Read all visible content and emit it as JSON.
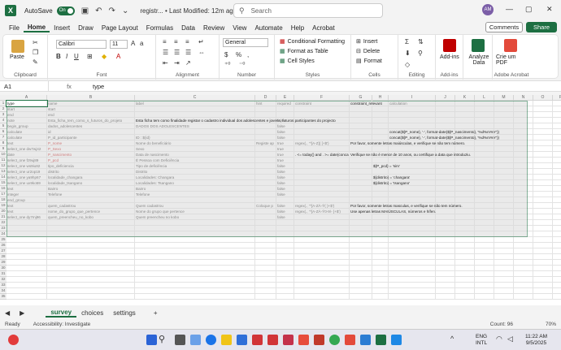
{
  "titlebar": {
    "app_letter": "X",
    "autosave_label": "AutoSave",
    "autosave_state": "On",
    "doc_title": "registr... • Last Modified: 12m ago",
    "search_placeholder": "Search",
    "avatar_initials": "AM"
  },
  "menu": {
    "items": [
      "File",
      "Home",
      "Insert",
      "Draw",
      "Page Layout",
      "Formulas",
      "Data",
      "Review",
      "View",
      "Automate",
      "Help",
      "Acrobat"
    ],
    "comments_label": "Comments",
    "share_label": "Share"
  },
  "ribbon": {
    "clipboard_label": "Clipboard",
    "paste_label": "Paste",
    "font_label": "Font",
    "font_name": "Calibri",
    "font_size": "11",
    "alignment_label": "Alignment",
    "number_label": "Number",
    "number_format": "General",
    "styles_label": "Styles",
    "conditional_formatting": "Conditional Formatting",
    "format_as_table": "Format as Table",
    "cell_styles": "Cell Styles",
    "cells_label": "Cells",
    "insert": "Insert",
    "delete": "Delete",
    "format": "Format",
    "editing_label": "Editing",
    "addins_group": "Add-ins",
    "addins_btn": "Add-ins",
    "analyze_data": "Analyze Data",
    "create_pdf": "Crie um PDF",
    "acrobat_label": "Adobe Acrobat"
  },
  "formula_bar": {
    "name_box": "A1",
    "fx": "fx",
    "value": "type"
  },
  "columns": [
    "A",
    "B",
    "C",
    "D",
    "E",
    "F",
    "G",
    "H",
    "I",
    "J",
    "K",
    "L",
    "M",
    "N",
    "O",
    "P"
  ],
  "rows": [
    [
      "type",
      "name",
      "label",
      "hint",
      "required",
      "constraint",
      "constraint_relevant",
      "",
      "calculation",
      "",
      "",
      "",
      "",
      "",
      "",
      ""
    ],
    [
      "start",
      "start",
      "",
      "",
      "",
      "",
      "",
      "",
      "",
      "",
      "",
      "",
      "",
      "",
      "",
      ""
    ],
    [
      "end",
      "end",
      "",
      "",
      "",
      "",
      "",
      "",
      "",
      "",
      "",
      "",
      "",
      "",
      "",
      ""
    ],
    [
      "note",
      "Esta_ficha_tem_como_s_futuros_do_projeto",
      "Esta ficha tem como finalidade registar o cadastro individual dos adolescentes e jovens, futuros participantes do projecto",
      "",
      "false",
      "",
      "",
      "",
      "",
      "",
      "",
      "",
      "",
      "",
      "",
      ""
    ],
    [
      "begin_group",
      "dados_adolescentes",
      "DADOS DOS ADOLESCENTES",
      "",
      "false",
      "",
      "",
      "",
      "",
      "",
      "",
      "",
      "",
      "",
      "",
      ""
    ],
    [
      "calculate",
      "id",
      "",
      "",
      "false",
      "",
      "",
      "",
      "concat(${P_nome}, '-', format-date(${P_nascimento}, '%d%m%Y'))",
      "",
      "",
      "",
      "",
      "",
      "",
      ""
    ],
    [
      "calculate",
      "P_id_participante",
      "ID : ${id}",
      "",
      "false",
      "",
      "",
      "",
      "concat(${P_nome}, '-', format-date(${P_nascimento}, '%d%m%Y'))",
      "",
      "",
      "",
      "",
      "",
      "",
      ""
    ],
    [
      "text",
      "P_nome",
      "Nome do beneficiário",
      "Registe ap",
      "true",
      "regex(., '^[A-Z]( [+$')",
      "Por favor, somente letras maiúsculas, e verifique se não tem número.",
      "",
      "",
      "",
      "",
      "",
      "",
      "",
      "",
      ""
    ],
    [
      "select_one dw7wj42",
      "P_Sexo",
      "Sexo",
      "",
      "true",
      "",
      "",
      "",
      "",
      "",
      "",
      "",
      "",
      "",
      "",
      ""
    ],
    [
      "date",
      "P_nascimento",
      "Data de nascimento",
      "",
      "true",
      ". <= today() and . >= date(conca",
      "Verifique se não é menor de 10 anos, ou certifique a data que introduziu.",
      "",
      "",
      "",
      "",
      "",
      "",
      "",
      "",
      ""
    ],
    [
      "select_one fz9uj89",
      "P_pcd",
      "É Pessoa com Deficiência",
      "",
      "true",
      "",
      "",
      "",
      "",
      "",
      "",
      "",
      "",
      "",
      "",
      ""
    ],
    [
      "select_one ws9iu82",
      "tipo_deficiencia",
      "Tipo de deficiência",
      "",
      "false",
      "",
      "",
      "${P_pcd} = 'sim'",
      "",
      "",
      "",
      "",
      "",
      "",
      "",
      ""
    ],
    [
      "select_one ur2op19",
      "distrito",
      "Distrito",
      "",
      "false",
      "",
      "",
      "",
      "",
      "",
      "",
      "",
      "",
      "",
      "",
      ""
    ],
    [
      "select_one ya9hp67",
      "localidade_changara",
      "Localidades: Changara",
      "",
      "false",
      "",
      "",
      "${distrito} = 'changara'",
      "",
      "",
      "",
      "",
      "",
      "",
      "",
      ""
    ],
    [
      "select_one ux9ko59",
      "localidade_tsangano",
      "Localidades: Tsangano",
      "",
      "false",
      "",
      "",
      "${distrito} = 'tsangano'",
      "",
      "",
      "",
      "",
      "",
      "",
      "",
      ""
    ],
    [
      "text",
      "Bairro",
      "Bairro",
      "",
      "false",
      "",
      "",
      "",
      "",
      "",
      "",
      "",
      "",
      "",
      "",
      ""
    ],
    [
      "integer",
      "Telefone",
      "Telefone",
      "",
      "false",
      "",
      "",
      "",
      "",
      "",
      "",
      "",
      "",
      "",
      "",
      ""
    ],
    [
      "end_group",
      "",
      "",
      "",
      "",
      "",
      "",
      "",
      "",
      "",
      "",
      "",
      "",
      "",
      "",
      ""
    ],
    [
      "text",
      "quem_cadastrou",
      "Quem cadastrou",
      "Coloque p",
      "false",
      "regex(., '^[A-ZÀ-Ÿ( )+$')",
      "Por favor, somente letras masculas, e verifique se não tem número.",
      "",
      "",
      "",
      "",
      "",
      "",
      "",
      "",
      ""
    ],
    [
      "text",
      "nome_do_grupo_que_pertence",
      "Nome do grupo que pertence",
      "",
      "false",
      "regex(., '^[A-ZÀ-Ÿ0-9\\- ]+$')",
      "Use apenas letras MAIÚSCULAS, números e hífen.",
      "",
      "",
      "",
      "",
      "",
      "",
      "",
      "",
      ""
    ],
    [
      "select_one dy7mj96",
      "quem_preencheu_no_kobo",
      "Quem preencheu no kobo",
      "",
      "false",
      "",
      "",
      "",
      "",
      "",
      "",
      "",
      "",
      "",
      "",
      ""
    ],
    [
      "",
      "",
      "",
      "",
      "",
      "",
      "",
      "",
      "",
      "",
      "",
      "",
      "",
      "",
      "",
      ""
    ],
    [
      "",
      "",
      "",
      "",
      "",
      "",
      "",
      "",
      "",
      "",
      "",
      "",
      "",
      "",
      "",
      ""
    ]
  ],
  "sheets": [
    "survey",
    "choices",
    "settings"
  ],
  "status": {
    "ready": "Ready",
    "accessibility": "Accessibility: Investigate",
    "count": "Count: 96",
    "zoom": "70%"
  },
  "taskbar": {
    "lang": "ENG",
    "lang2": "INTL",
    "time": "11:22 AM",
    "date": "9/5/2025"
  },
  "colors": {
    "excel_green": "#1d6f42",
    "red_text": "#c00000"
  }
}
